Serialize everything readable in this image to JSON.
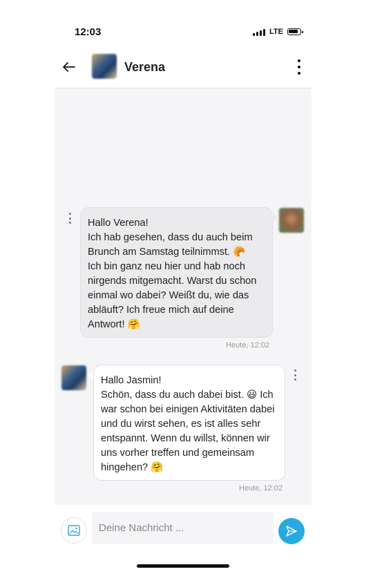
{
  "status_bar": {
    "time": "12:03",
    "network": "LTE"
  },
  "header": {
    "contact_name": "Verena",
    "back_icon": "arrow-left-icon",
    "menu_icon": "more-vertical-icon"
  },
  "messages": [
    {
      "text": "Hallo Verena!\nIch hab gesehen, dass du auch beim Brunch am Samstag teilnimmst. 🥐\nIch bin ganz neu hier und hab noch nirgends mitgemacht. Warst du schon einmal wo dabei? Weißt du, wie das abläuft? Ich freue mich auf deine Antwort! 🤗",
      "timestamp": "Heute, 12:02"
    },
    {
      "text": "Hallo Jasmin!\nSchön, dass du auch dabei bist. 😃 Ich war schon bei einigen Aktivitäten dabei und du wirst sehen, es ist alles sehr entspannt. Wenn du willst, können wir uns vorher treffen und gemeinsam hingehen? 🤗",
      "timestamp": "Heute, 12:02"
    }
  ],
  "composer": {
    "placeholder": "Deine Nachricht ...",
    "value": ""
  },
  "colors": {
    "accent": "#27a9e1",
    "chat_background": "#f5f5f7",
    "bubble_incoming": "#ebebed",
    "bubble_outgoing": "#ffffff"
  }
}
